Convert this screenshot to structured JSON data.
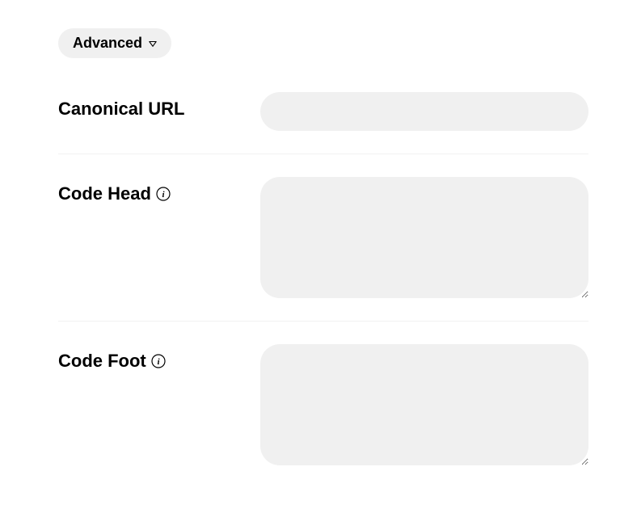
{
  "section": {
    "title": "Advanced"
  },
  "fields": {
    "canonical_url": {
      "label": "Canonical URL",
      "value": ""
    },
    "code_head": {
      "label": "Code Head",
      "value": ""
    },
    "code_foot": {
      "label": "Code Foot",
      "value": ""
    }
  }
}
